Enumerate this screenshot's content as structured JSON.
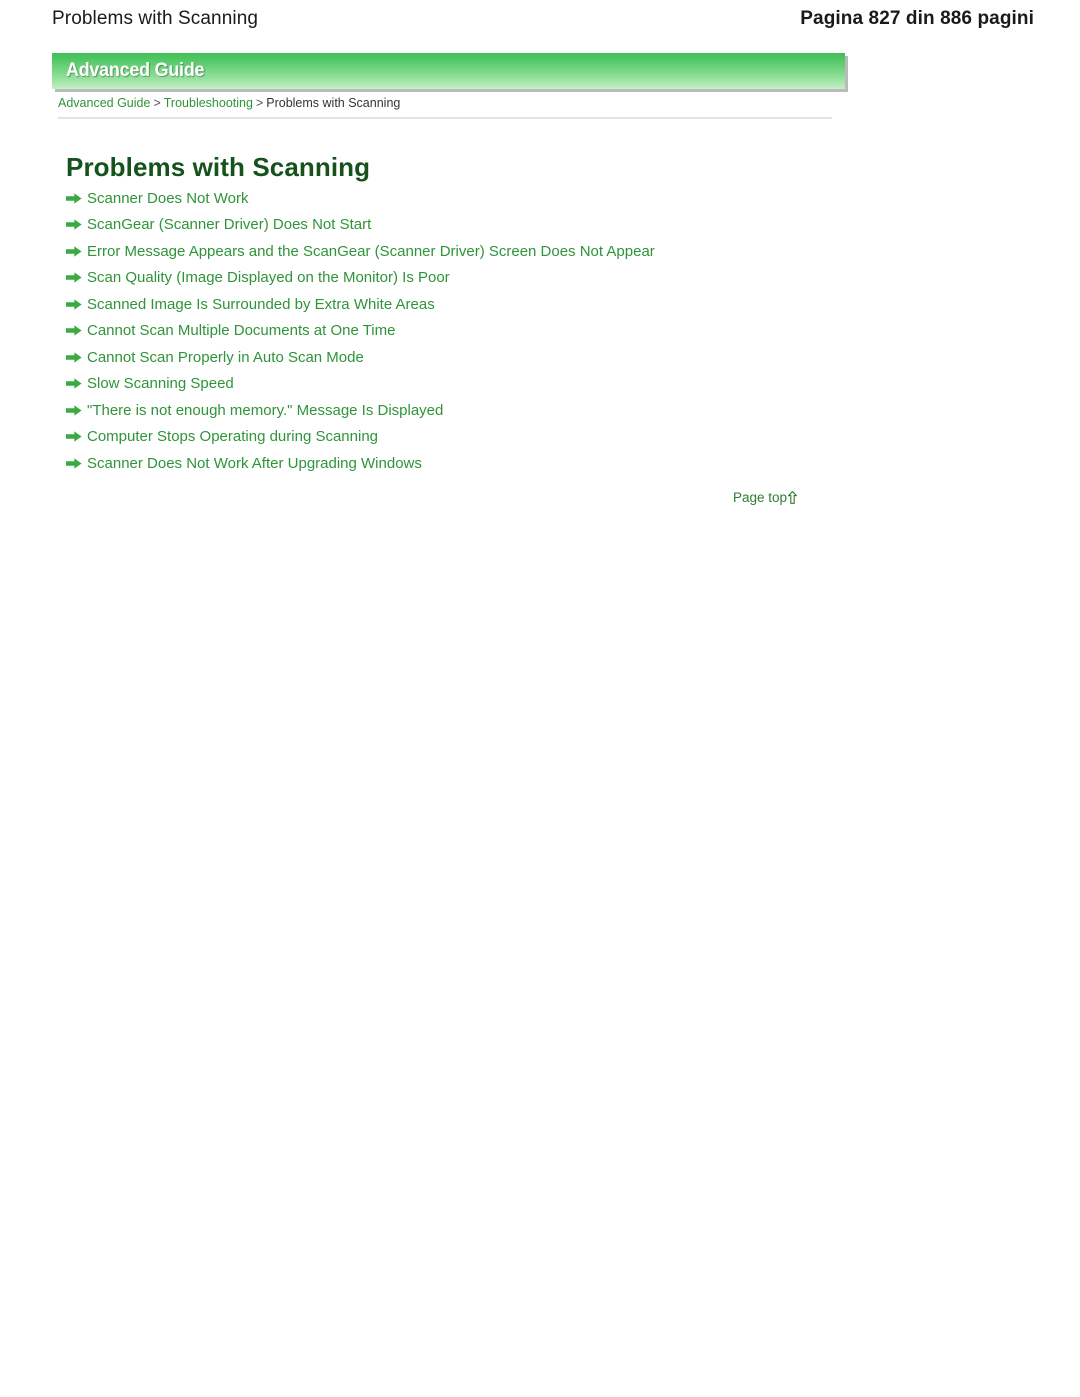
{
  "page_header": {
    "title": "Problems with Scanning",
    "pagination": "Pagina 827 din 886 pagini"
  },
  "banner": {
    "label": "Advanced Guide",
    "gradient_top": "#3fbf55",
    "gradient_bottom": "#c6f0c8"
  },
  "breadcrumb": {
    "items": [
      {
        "label": "Advanced Guide",
        "link": true
      },
      {
        "label": "Troubleshooting",
        "link": true
      },
      {
        "label": "Problems with Scanning",
        "link": false
      }
    ],
    "separator": ">"
  },
  "document": {
    "title": "Problems with Scanning",
    "title_color": "#15521c",
    "link_color": "#2f9439"
  },
  "links": [
    {
      "label": "Scanner Does Not Work"
    },
    {
      "label": "ScanGear (Scanner Driver) Does Not Start"
    },
    {
      "label": "Error Message Appears and the ScanGear (Scanner Driver) Screen Does Not Appear"
    },
    {
      "label": "Scan Quality (Image Displayed on the Monitor) Is Poor"
    },
    {
      "label": "Scanned Image Is Surrounded by Extra White Areas"
    },
    {
      "label": "Cannot Scan Multiple Documents at One Time"
    },
    {
      "label": "Cannot Scan Properly in Auto Scan Mode"
    },
    {
      "label": "Slow Scanning Speed"
    },
    {
      "label": "\"There is not enough memory.\" Message Is Displayed"
    },
    {
      "label": "Computer Stops Operating during Scanning"
    },
    {
      "label": "Scanner Does Not Work After Upgrading Windows"
    }
  ],
  "page_top": {
    "label": "Page top",
    "icon": "arrow-up-icon"
  }
}
